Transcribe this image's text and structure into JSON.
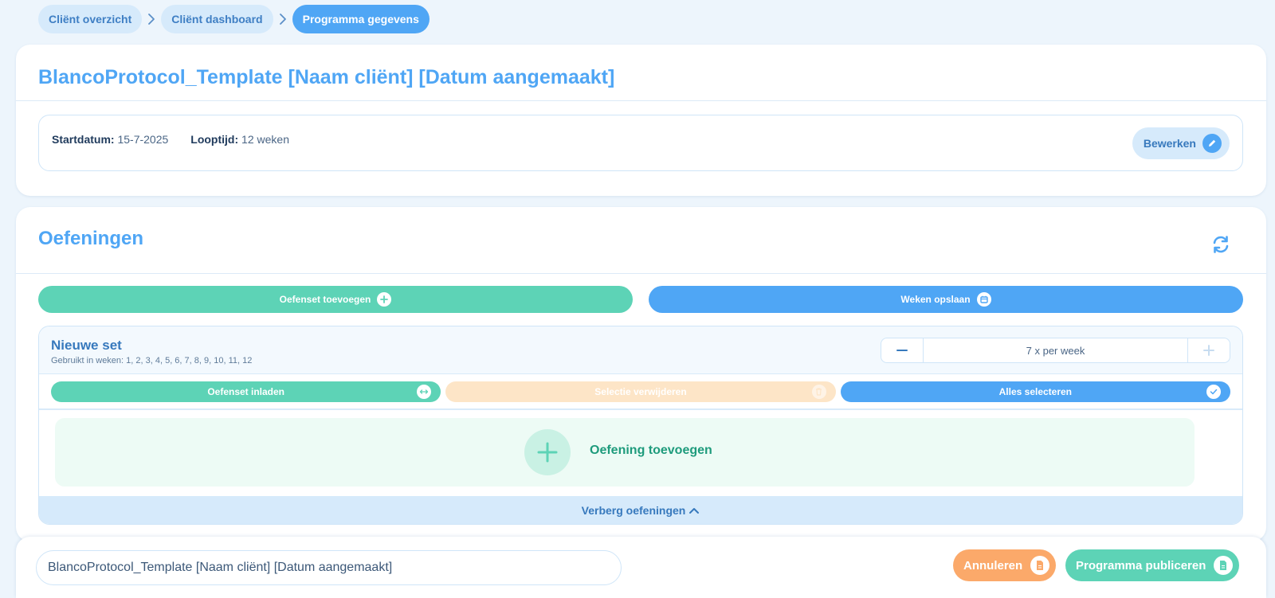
{
  "breadcrumb": {
    "items": [
      {
        "label": "Cliënt overzicht"
      },
      {
        "label": "Cliënt dashboard"
      },
      {
        "label": "Programma gegevens"
      }
    ]
  },
  "program": {
    "title": "BlancoProtocol_Template [Naam cliënt] [Datum aangemaakt]",
    "start_label": "Startdatum:",
    "start_value": "15-7-2025",
    "duration_label": "Looptijd:",
    "duration_value": "12 weken",
    "edit_label": "Bewerken"
  },
  "exercises": {
    "title": "Oefeningen",
    "add_set_label": "Oefenset toevoegen",
    "save_weeks_label": "Weken opslaan",
    "set": {
      "title": "Nieuwe set",
      "used_in_weeks": "Gebruikt in weken: 1, 2, 3, 4, 5, 6, 7, 8, 9, 10, 11, 12",
      "frequency_text": "7 x per week",
      "load_set_label": "Oefenset inladen",
      "delete_selection_label": "Selectie verwijderen",
      "select_all_label": "Alles selecteren",
      "add_exercise_label": "Oefening toevoegen",
      "hide_label": "Verberg oefeningen"
    }
  },
  "footer": {
    "name_value": "BlancoProtocol_Template [Naam cliënt] [Datum aangemaakt]",
    "cancel_label": "Annuleren",
    "publish_label": "Programma publiceren"
  },
  "colors": {
    "accent_blue": "#4fa6f5",
    "accent_green": "#5dd3b6",
    "accent_orange": "#fba96a",
    "background": "#edf5fc"
  },
  "icons": {
    "crumb_separator": "chevron-right-icon",
    "edit": "pencil-icon",
    "refresh": "refresh-icon",
    "add": "plus-icon",
    "calendar": "calendar-icon",
    "load": "swap-icon",
    "delete": "trash-icon",
    "select": "check-icon",
    "hide": "chevron-up-icon",
    "document": "document-icon"
  }
}
